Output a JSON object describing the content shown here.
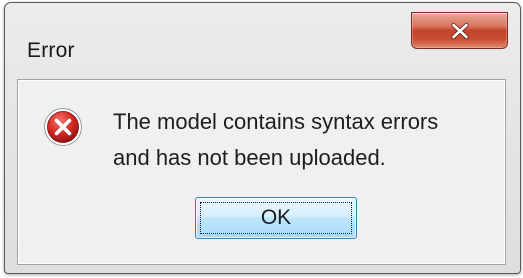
{
  "dialog": {
    "title": "Error",
    "message_lines": [
      "The model contains syntax errors",
      "and has not been uploaded."
    ],
    "icon": "error-icon",
    "ok_label": "OK",
    "close_icon": "close-icon"
  },
  "colors": {
    "close_button": "#c7503a",
    "error_icon": "#c1272d",
    "ok_button_border": "#3c7fb1",
    "ok_button_fill": "#bee6fd"
  }
}
